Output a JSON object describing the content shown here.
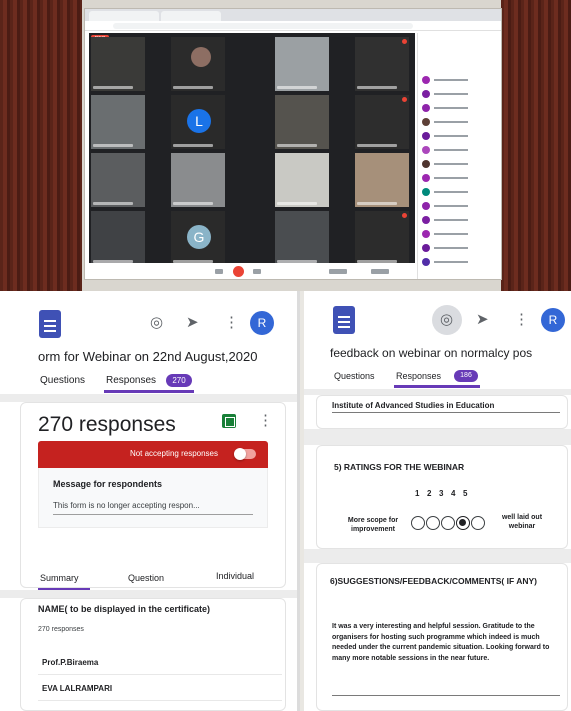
{
  "colors": {
    "forms_purple": "#673ab7",
    "forms_logo_blue": "#3f51b5",
    "avatar_blue": "#3367d6",
    "closed_red": "#c5221f",
    "sheets_green": "#188038",
    "meet_dark": "#202124"
  },
  "meet": {
    "tile_letters": [
      "L",
      "G"
    ]
  },
  "left_form": {
    "title": "orm for Webinar on 22nd August,2020",
    "avatar_letter": "R",
    "toolbar_icons": [
      "palette-icon",
      "send-icon",
      "more-vert-icon"
    ],
    "tabs": [
      {
        "label": "Questions",
        "active": false
      },
      {
        "label": "Responses",
        "active": true,
        "badge": "270"
      }
    ],
    "response_count": "270 responses",
    "accepting_label": "Not accepting responses",
    "accepting": false,
    "message_label": "Message for respondents",
    "message_text": "This form is no longer accepting respon...",
    "subtabs": [
      "Summary",
      "Question",
      "Individual"
    ],
    "active_subtab": "Summary",
    "question": {
      "title": "NAME( to be displayed in the certificate)",
      "count": "270 responses",
      "answers": [
        "Prof.P.Biraema",
        "EVA LALRAMPARI"
      ]
    }
  },
  "right_form": {
    "title": "feedback on webinar on normalcy pos",
    "avatar_letter": "R",
    "toolbar_icons": [
      "palette-icon",
      "send-icon",
      "more-vert-icon"
    ],
    "tabs": [
      {
        "label": "Questions",
        "active": false
      },
      {
        "label": "Responses",
        "active": true,
        "badge": "186"
      }
    ],
    "institute_answer": "Institute of Advanced Studies in Education",
    "rating": {
      "title": "5) RATINGS FOR THE WEBINAR",
      "scale": [
        "1",
        "2",
        "3",
        "4",
        "5"
      ],
      "low_label": "More scope for improvement",
      "high_label": "well laid out webinar",
      "selected": 4
    },
    "suggestions": {
      "title": "6)SUGGESTIONS/FEEDBACK/COMMENTS( IF ANY)",
      "answer": "It was a very interesting and helpful session. Gratitude to the organisers for hosting such programme which indeed is much needed under the current pandemic situation. Looking forward to many more notable sessions in the near future."
    }
  }
}
